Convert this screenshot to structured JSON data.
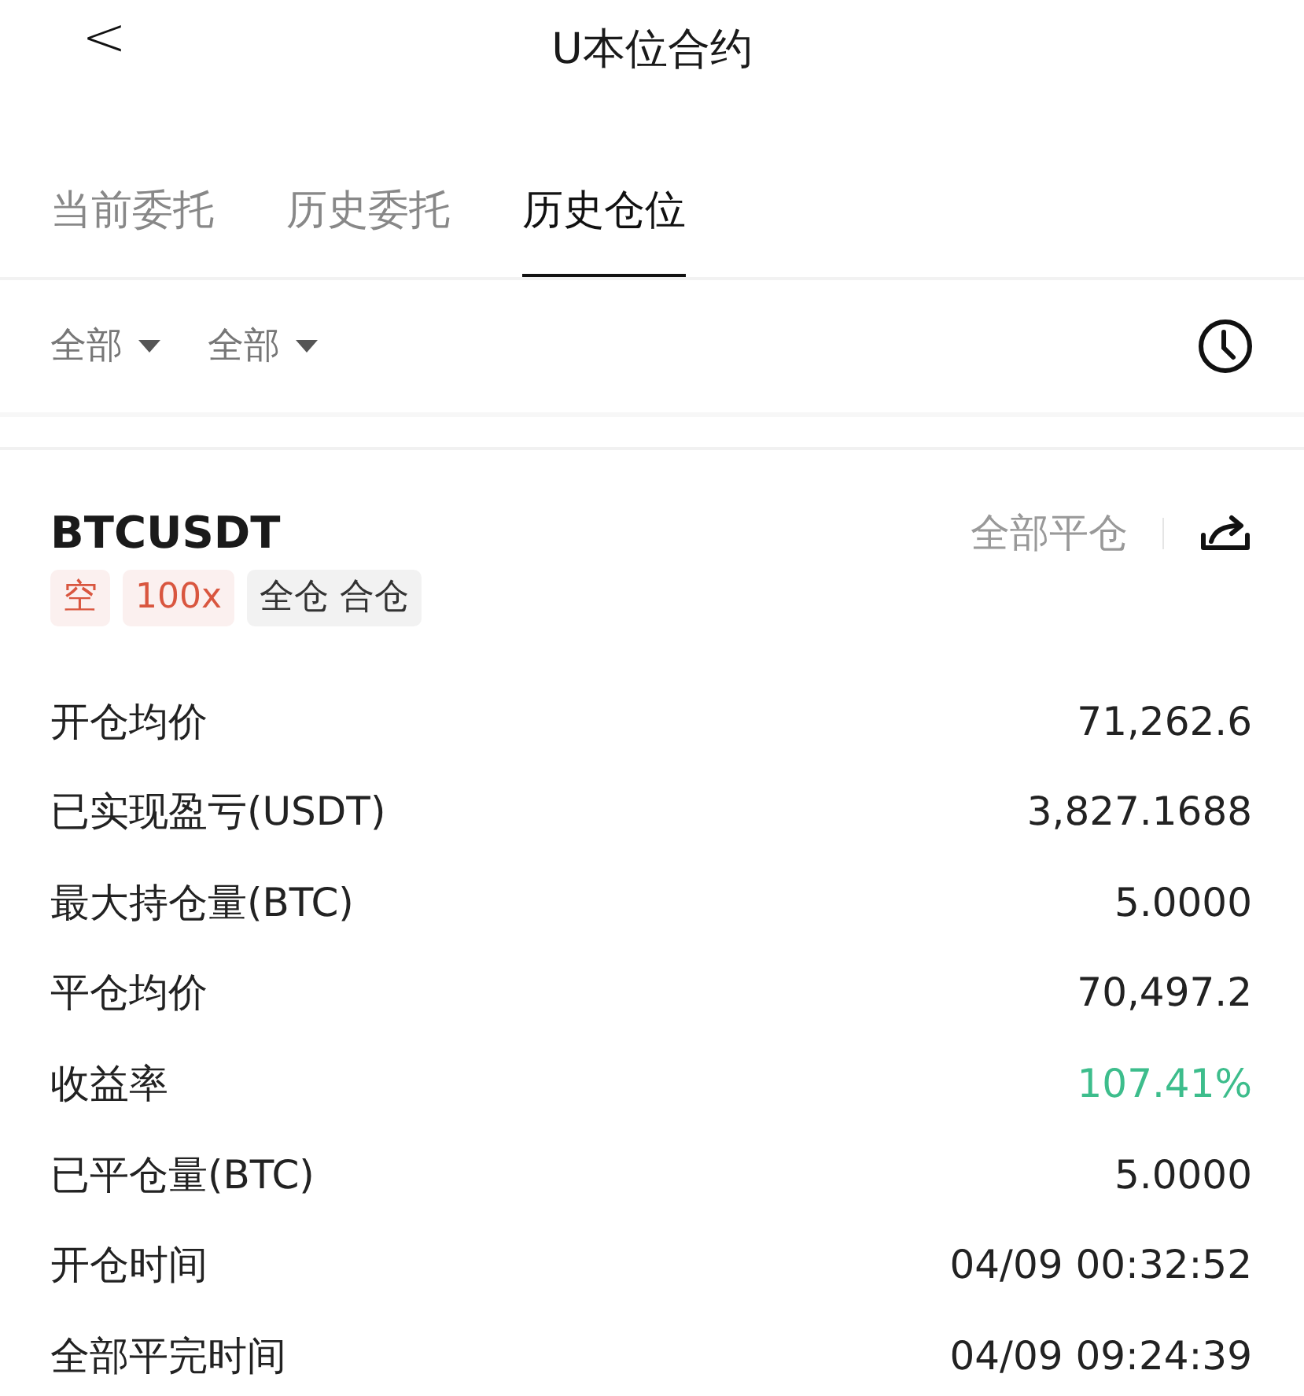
{
  "header": {
    "back": "<",
    "title": "U本位合约"
  },
  "tabs": [
    {
      "label": "当前委托",
      "selected": false
    },
    {
      "label": "历史委托",
      "selected": false
    },
    {
      "label": "历史仓位",
      "selected": true
    }
  ],
  "filters": [
    {
      "label": "全部"
    },
    {
      "label": "全部"
    }
  ],
  "position": {
    "symbol": "BTCUSDT",
    "close_all": "全部平仓",
    "tags": [
      {
        "label": "空",
        "kind": "side"
      },
      {
        "label": "100x",
        "kind": "side"
      },
      {
        "label": "全仓 合仓",
        "kind": "mode"
      }
    ],
    "rows": [
      {
        "label": "开仓均价",
        "value": "71,262.6",
        "kind": "plain"
      },
      {
        "label": "已实现盈亏(USDT)",
        "value": "3,827.1688",
        "kind": "plain"
      },
      {
        "label": "最大持仓量(BTC)",
        "value": "5.0000",
        "kind": "plain"
      },
      {
        "label": "平仓均价",
        "value": "70,497.2",
        "kind": "plain"
      },
      {
        "label": "收益率",
        "value": "107.41%",
        "kind": "gain"
      },
      {
        "label": "已平仓量(BTC)",
        "value": "5.0000",
        "kind": "plain"
      },
      {
        "label": "开仓时间",
        "value": "04/09 00:32:52",
        "kind": "plain"
      },
      {
        "label": "全部平完时间",
        "value": "04/09 09:24:39",
        "kind": "plain"
      }
    ]
  }
}
